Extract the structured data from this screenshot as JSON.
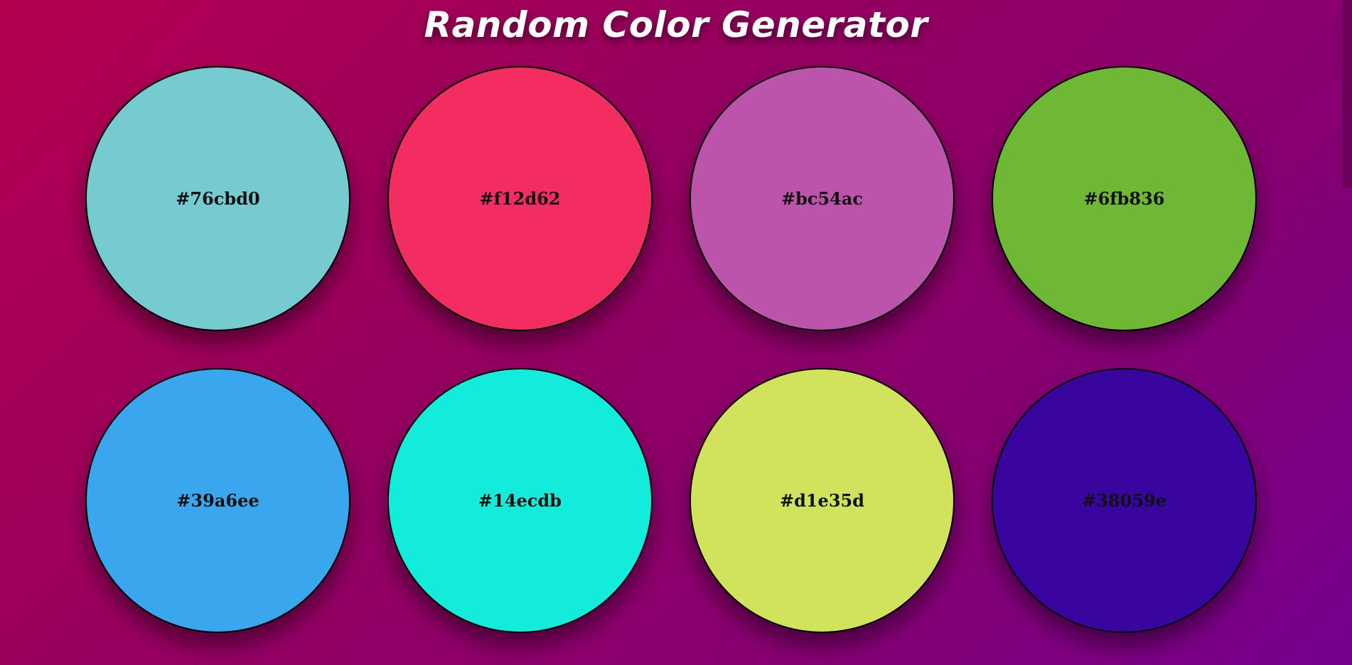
{
  "header": {
    "title": "Random Color Generator"
  },
  "colors": [
    {
      "hex": "#76cbd0",
      "fill": "#76cbd0"
    },
    {
      "hex": "#f12d62",
      "fill": "#f12d62"
    },
    {
      "hex": "#bc54ac",
      "fill": "#bc54ac"
    },
    {
      "hex": "#6fb836",
      "fill": "#6fb836"
    },
    {
      "hex": "#39a6ee",
      "fill": "#39a6ee"
    },
    {
      "hex": "#14ecdb",
      "fill": "#14ecdb"
    },
    {
      "hex": "#d1e35d",
      "fill": "#d1e35d"
    },
    {
      "hex": "#38059e",
      "fill": "#38059e"
    }
  ],
  "theme": {
    "background_start": "#b5004f",
    "background_end": "#74008e"
  }
}
